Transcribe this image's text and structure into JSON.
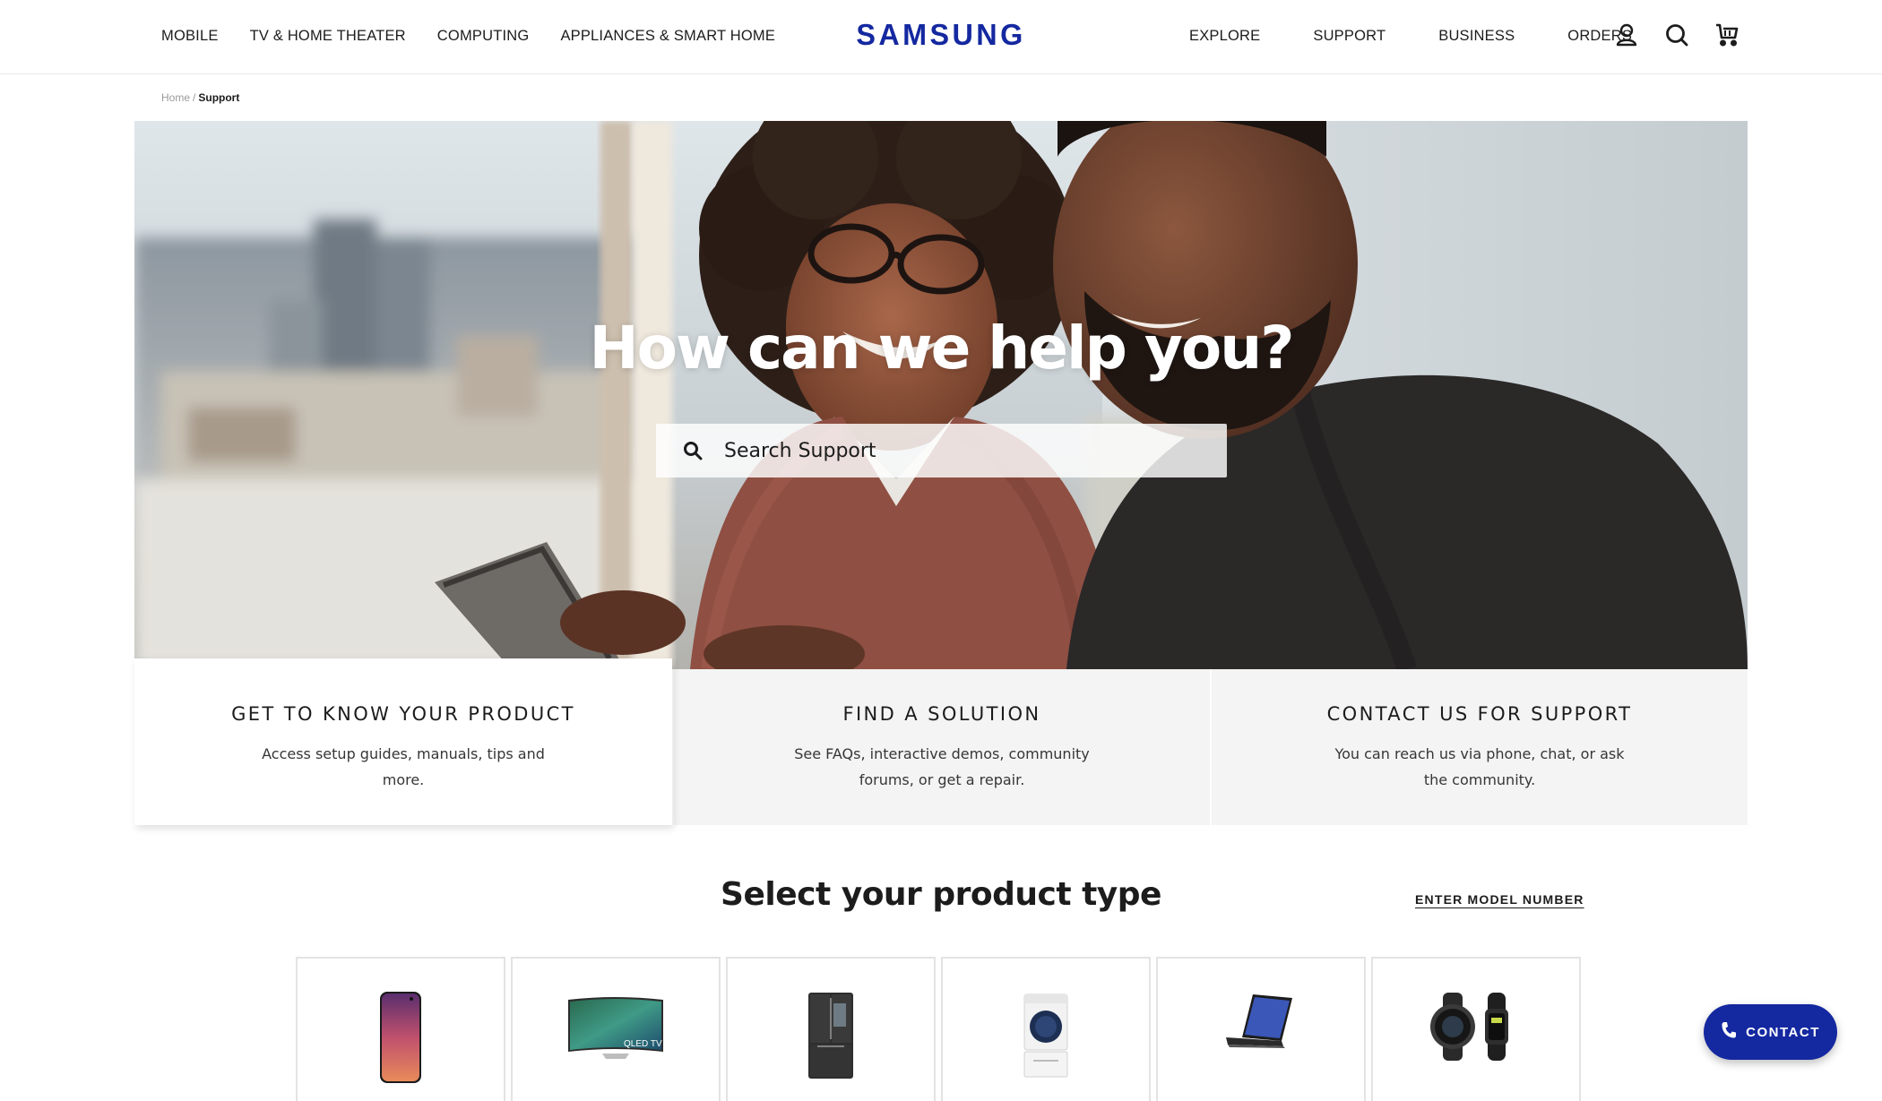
{
  "header": {
    "nav_left": [
      "MOBILE",
      "TV & HOME THEATER",
      "COMPUTING",
      "APPLIANCES & SMART HOME"
    ],
    "logo": "SAMSUNG",
    "nav_right": [
      "EXPLORE",
      "SUPPORT",
      "BUSINESS",
      "ORDERS"
    ],
    "icons": [
      "user-icon",
      "search-icon",
      "cart-icon"
    ]
  },
  "breadcrumb": {
    "home": "Home",
    "separator": "/",
    "current": "Support"
  },
  "hero": {
    "title": "How can we help you?",
    "search_placeholder": "Search Support"
  },
  "cards": [
    {
      "title": "GET TO KNOW YOUR PRODUCT",
      "description": "Access setup guides, manuals, tips and more."
    },
    {
      "title": "FIND A SOLUTION",
      "description": "See FAQs, interactive demos, community forums, or get a repair."
    },
    {
      "title": "CONTACT US FOR SUPPORT",
      "description": "You can reach us via phone, chat, or ask the community."
    }
  ],
  "product_section": {
    "title": "Select your product type",
    "model_link": "ENTER MODEL NUMBER",
    "products": [
      {
        "icon": "smartphone-icon"
      },
      {
        "icon": "tv-icon",
        "badge": "QLED TV"
      },
      {
        "icon": "refrigerator-icon"
      },
      {
        "icon": "washer-icon"
      },
      {
        "icon": "tablet-icon"
      },
      {
        "icon": "smartwatch-icon"
      }
    ]
  },
  "contact_button": {
    "label": "CONTACT",
    "icon": "phone-icon"
  },
  "colors": {
    "brand": "#1428a0",
    "text": "#1c1c1c",
    "card_bg": "#f4f4f4"
  }
}
